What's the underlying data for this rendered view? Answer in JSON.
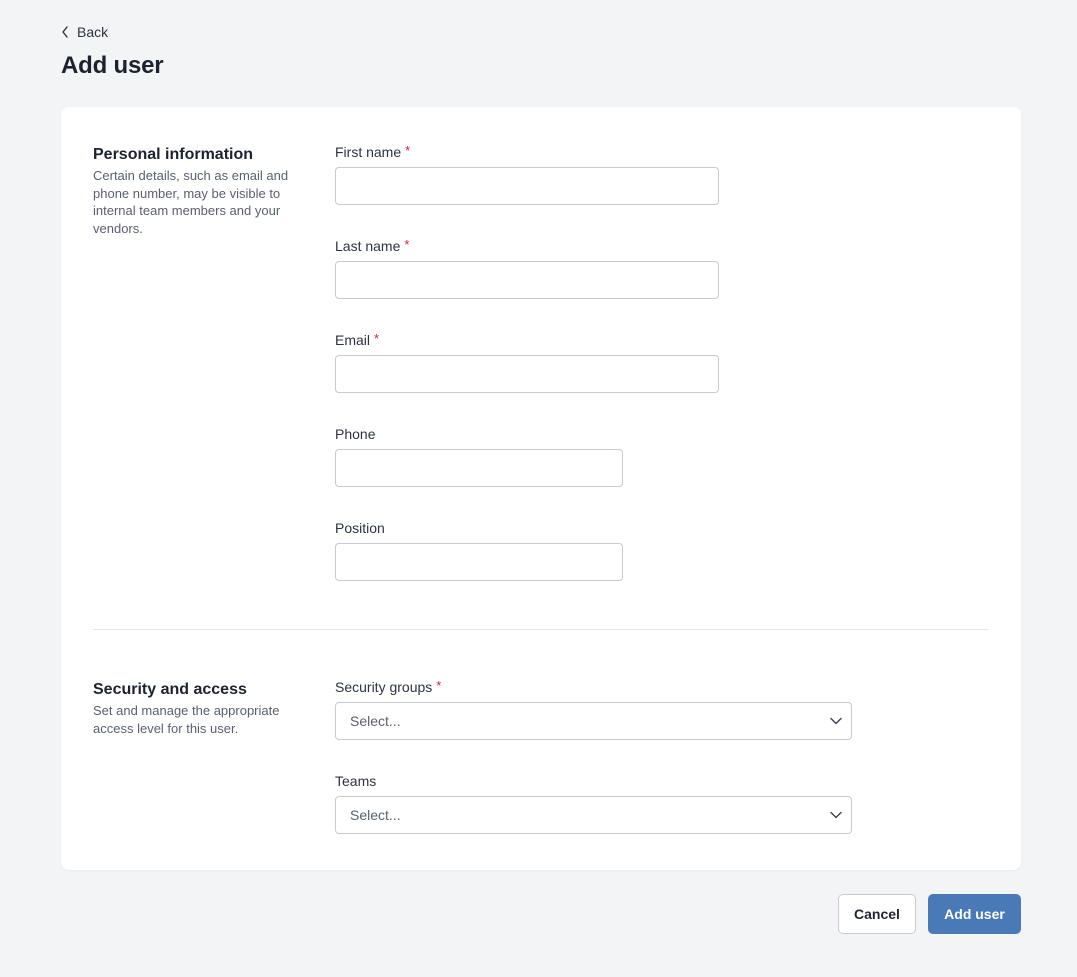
{
  "header": {
    "back_label": "Back",
    "title": "Add user"
  },
  "personal": {
    "title": "Personal information",
    "description": "Certain details, such as email and phone number, may be visible to internal team members and your vendors.",
    "fields": {
      "first_name": {
        "label": "First name",
        "required_mark": "*",
        "value": ""
      },
      "last_name": {
        "label": "Last name",
        "required_mark": "*",
        "value": ""
      },
      "email": {
        "label": "Email",
        "required_mark": "*",
        "value": ""
      },
      "phone": {
        "label": "Phone",
        "value": ""
      },
      "position": {
        "label": "Position",
        "value": ""
      }
    }
  },
  "security": {
    "title": "Security and access",
    "description": "Set and manage the appropriate access level for this user.",
    "security_groups": {
      "label": "Security groups",
      "required_mark": "*",
      "placeholder": "Select..."
    },
    "teams": {
      "label": "Teams",
      "placeholder": "Select..."
    }
  },
  "actions": {
    "cancel_label": "Cancel",
    "submit_label": "Add user"
  },
  "colors": {
    "primary": "#4a79b8",
    "required": "#d3252c",
    "background": "#f3f4f6"
  },
  "icons": {
    "back": "chevron-left-icon",
    "dropdown": "chevron-down-icon"
  }
}
